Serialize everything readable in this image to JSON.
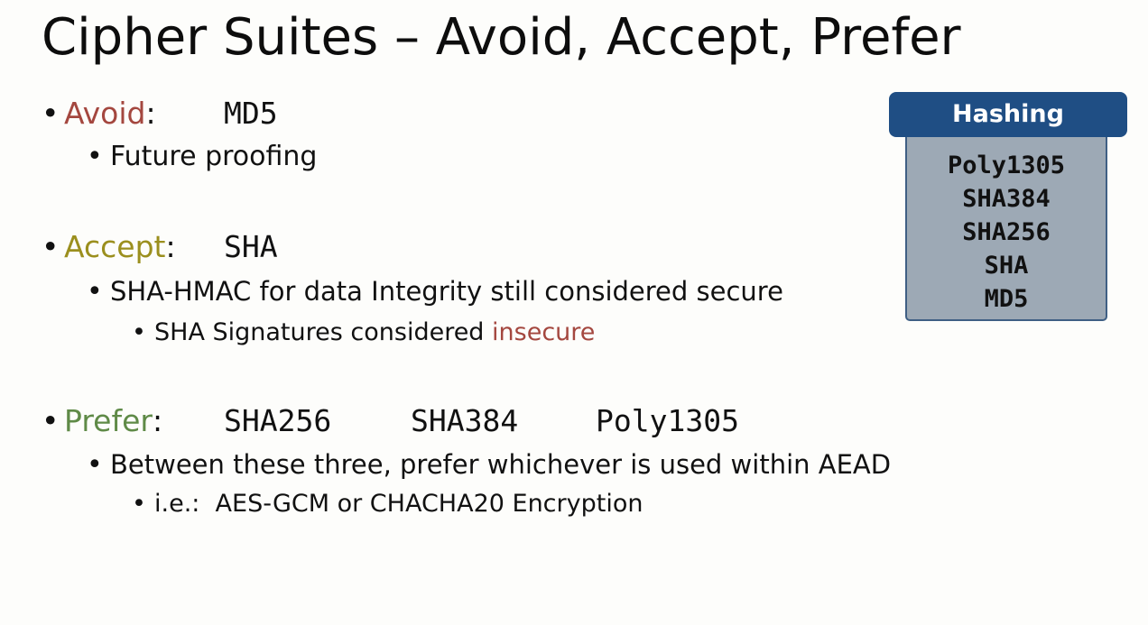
{
  "slide": {
    "title": "Cipher Suites – Avoid, Accept, Prefer",
    "bullet_l1": "•",
    "bullet_l2": "•",
    "bullet_l3": "•",
    "colors": {
      "avoid": "#a4473f",
      "accept": "#9b8f1e",
      "prefer": "#5f8a47",
      "insecure": "#a4473f",
      "hashing_header": "#1f4e84",
      "hashing_body": "#9da9b5"
    },
    "avoid": {
      "keyword": "Avoid",
      "colon": ":",
      "algorithm": "MD5",
      "sub": [
        "Future proofing"
      ]
    },
    "accept": {
      "keyword": "Accept",
      "colon": ":",
      "algorithm": "SHA",
      "sub": "SHA-HMAC for data Integrity still considered secure",
      "subsub_prefix": "SHA Signatures considered ",
      "subsub_highlight": "insecure"
    },
    "prefer": {
      "keyword": "Prefer",
      "colon": ":",
      "algorithms": [
        "SHA256",
        "SHA384",
        "Poly1305"
      ],
      "sub": "Between these three, prefer whichever is used within AEAD",
      "subsub": "i.e.:  AES-GCM or CHACHA20 Encryption"
    },
    "hashing_box": {
      "header": "Hashing",
      "items": [
        "Poly1305",
        "SHA384",
        "SHA256",
        "SHA",
        "MD5"
      ]
    }
  }
}
